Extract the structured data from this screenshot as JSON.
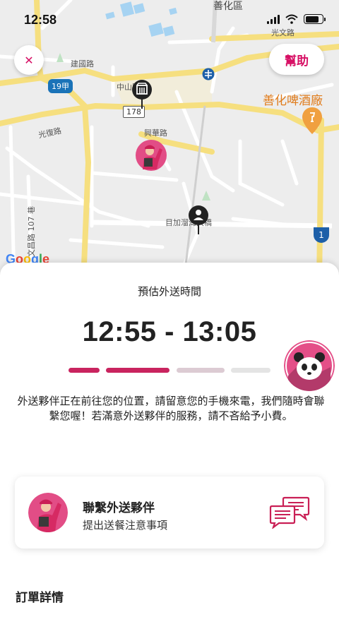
{
  "status_bar": {
    "time": "12:58",
    "battery_level": 0.8
  },
  "map": {
    "labels": {
      "district": "善化區",
      "road_guangwen_top": "光文路",
      "road_jianguo": "建國路",
      "road_zhongshan": "中山路",
      "road_guangfu": "光復路",
      "road_xinghua": "興華路",
      "road_wenchang": "文昌路 107 巷",
      "road_mujia": "目加溜灣大橋",
      "poi_brewery": "善化啤酒廠"
    },
    "shields": {
      "route_19jia": "19甲",
      "route_178": "178",
      "hwy_1": "1"
    },
    "google": "Google",
    "colors": {
      "main_road": "#f6df7f",
      "minor_road": "#ffffff",
      "water": "#9ed0f2",
      "land": "#eeeeee",
      "poi": "#e07b1a"
    }
  },
  "buttons": {
    "close_glyph": "✕",
    "help": "幫助"
  },
  "sheet": {
    "eta_label": "預估外送時間",
    "eta_time": "12:55 - 13:05",
    "progress": {
      "total_steps": 4,
      "completed_steps": 2,
      "active_color": "#c9245f",
      "next_color": "#dccbd3",
      "pending_color": "#e4e4e4"
    },
    "message": "外送夥伴正在前往您的位置，請留意您的手機來電，我們隨時會聯繫您喔！若滿意外送夥伴的服務，請不吝給予小費。",
    "contact": {
      "title": "聯繫外送夥伴",
      "subtitle": "提出送餐注意事項"
    },
    "order_details": "訂單詳情"
  },
  "brand_color": "#d70f64"
}
